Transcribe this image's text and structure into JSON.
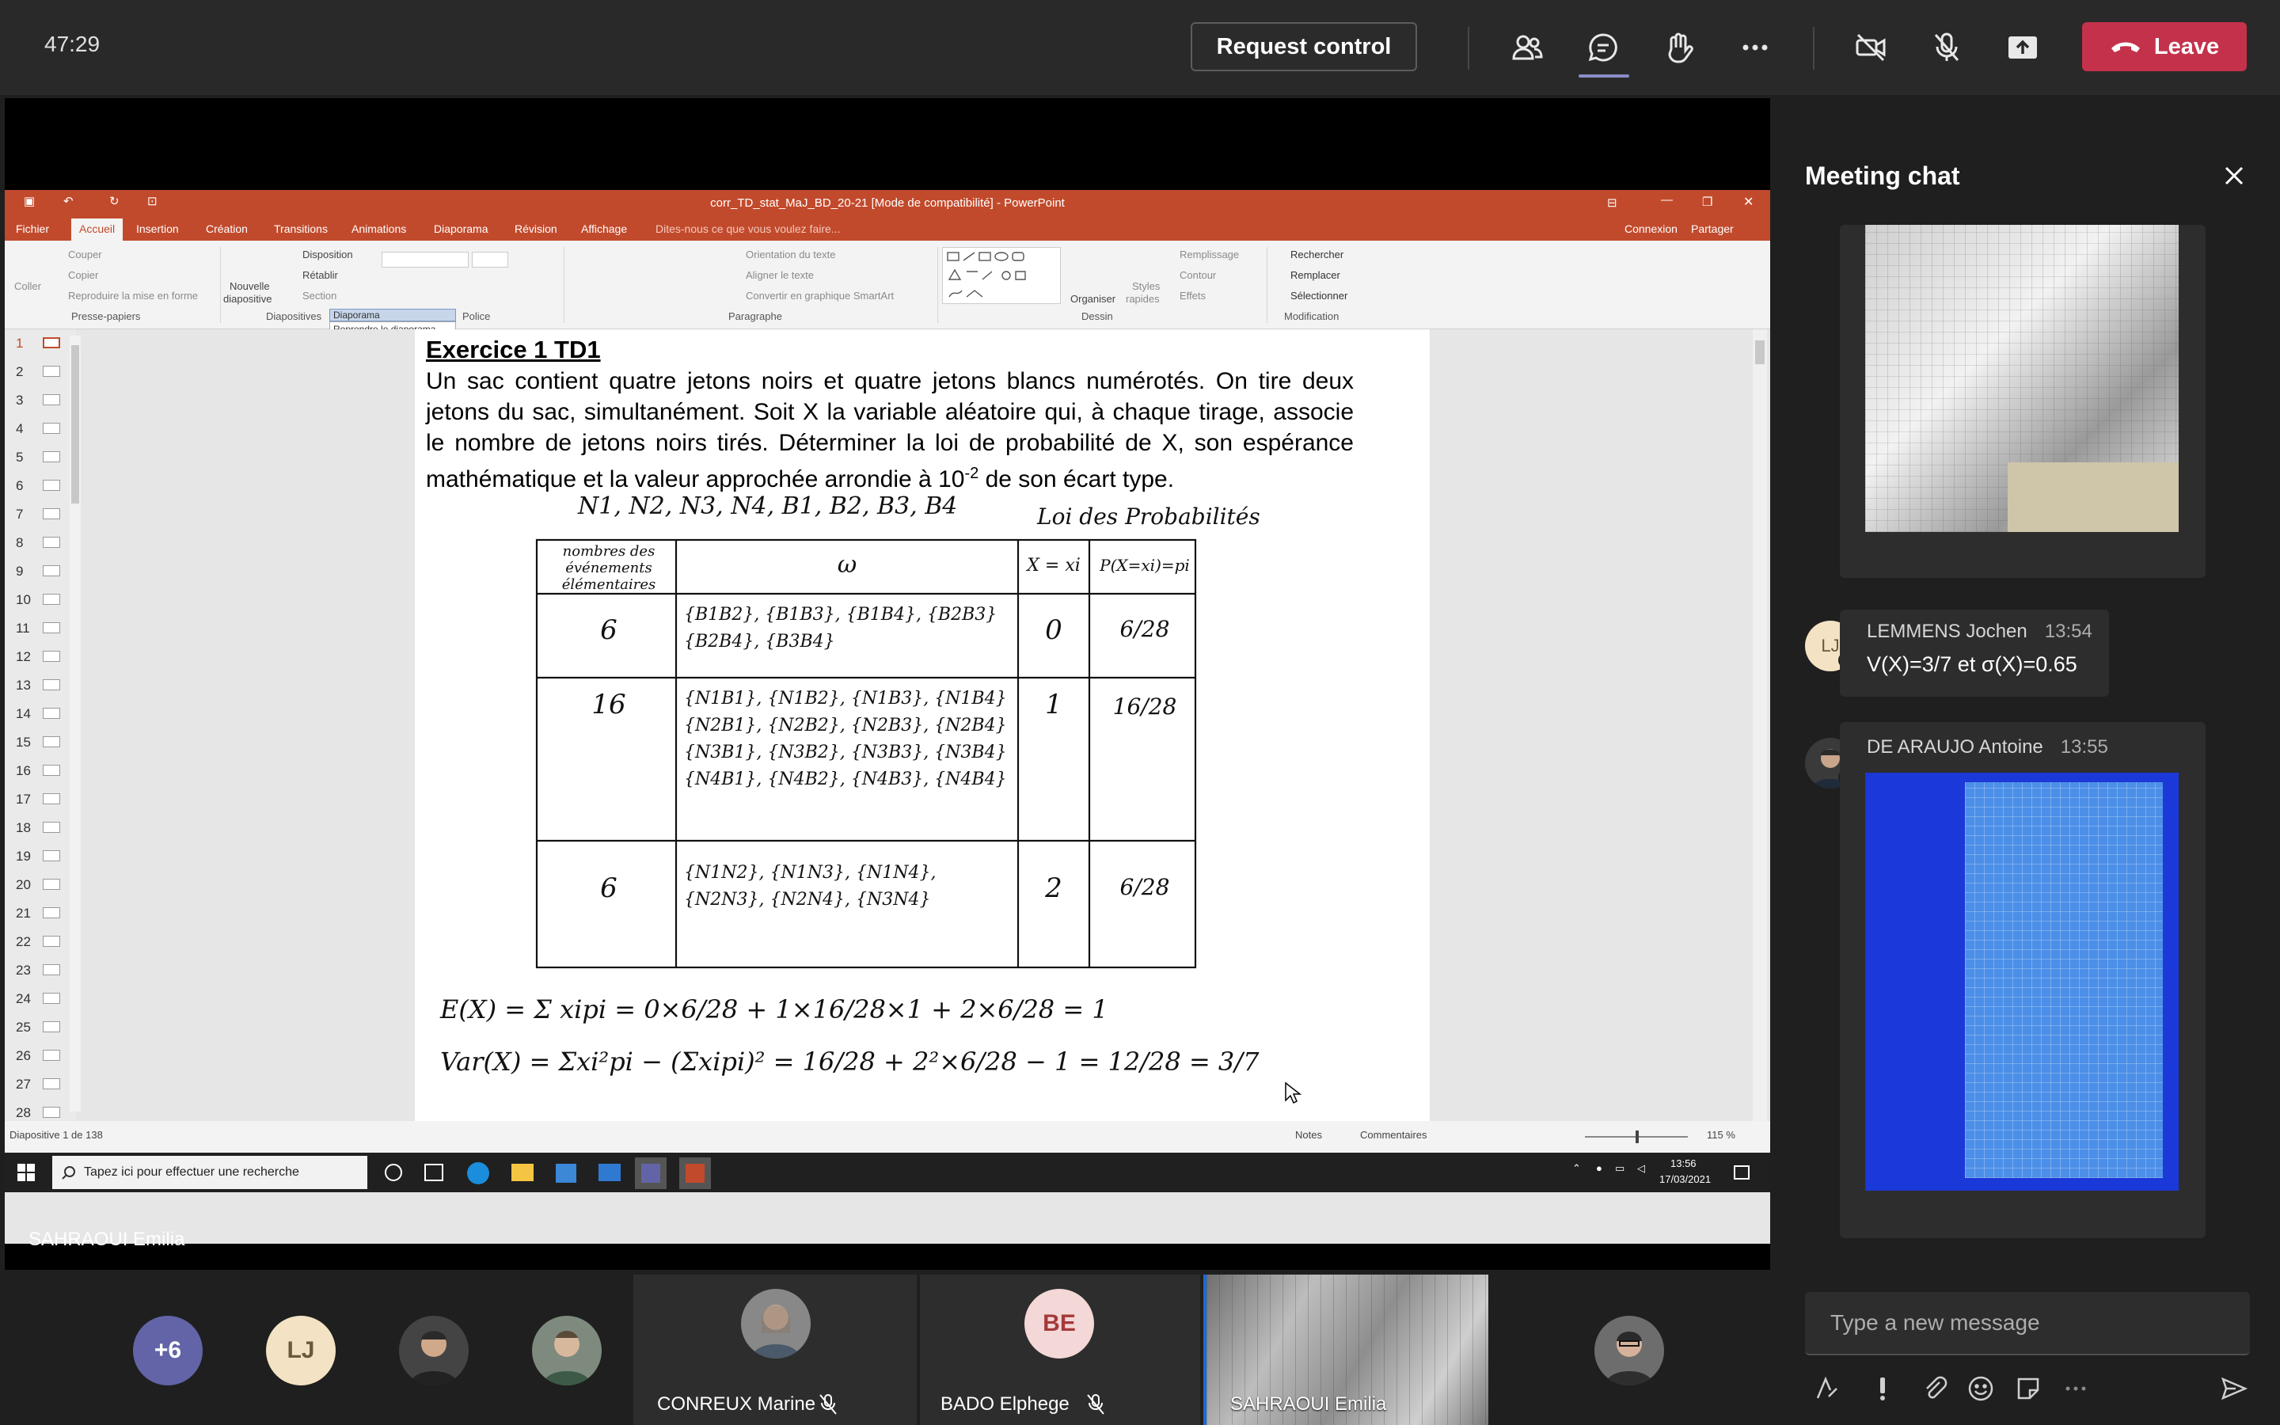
{
  "topbar": {
    "timer": "47:29",
    "request_control": "Request control",
    "leave": "Leave"
  },
  "icons": [
    "people-icon",
    "chat-icon",
    "raise-hand-icon",
    "more-icon",
    "camera-off-icon",
    "mic-off-icon",
    "share-icon",
    "phone-icon"
  ],
  "ppt": {
    "title": "corr_TD_stat_MaJ_BD_20-21 [Mode de compatibilité] - PowerPoint",
    "tabs": [
      "Fichier",
      "Accueil",
      "Insertion",
      "Création",
      "Transitions",
      "Animations",
      "Diaporama",
      "Révision",
      "Affichage"
    ],
    "tell_me": "Dites-nous ce que vous voulez faire...",
    "connexion": "Connexion",
    "partager": "Partager",
    "ribbon": {
      "coller": "Coller",
      "couper": "Couper",
      "copier": "Copier",
      "reproduire": "Reproduire la mise en forme",
      "presse_papiers": "Presse-papiers",
      "nouvelle": "Nouvelle",
      "diapositive": "diapositive",
      "disposition": "Disposition",
      "retablir": "Rétablir",
      "section": "Section",
      "diapositives": "Diapositives",
      "diaporama_popup": "Diaporama",
      "reprendre": "Reprendre le diaporama",
      "police": "Police",
      "orientation": "Orientation du texte",
      "aligner": "Aligner le texte",
      "smartart": "Convertir en graphique SmartArt",
      "paragraphe": "Paragraphe",
      "organiser": "Organiser",
      "styles": "Styles",
      "rapides": "rapides",
      "remplissage": "Remplissage",
      "contour": "Contour",
      "effets": "Effets",
      "dessin": "Dessin",
      "rechercher": "Rechercher",
      "remplacer": "Remplacer",
      "selectionner": "Sélectionner",
      "modification": "Modification"
    },
    "thumb_numbers": [
      "1",
      "2",
      "3",
      "4",
      "5",
      "6",
      "7",
      "8",
      "9",
      "10",
      "11",
      "12",
      "13",
      "14",
      "15",
      "16",
      "17",
      "18",
      "19",
      "20",
      "21",
      "22",
      "23",
      "24",
      "25",
      "26",
      "27",
      "28"
    ],
    "slide": {
      "title": "Exercice 1 TD1",
      "paragraph": "Un sac contient quatre jetons noirs et quatre jetons blancs numérotés. On tire deux jetons du sac, simultanément. Soit X la variable aléatoire qui, à chaque tirage, associe le nombre de jetons noirs tirés. Déterminer la loi de probabilité de X, son espérance mathématique et la valeur approchée arrondie à 10",
      "exp": "-2",
      "paragraph_end": " de son écart type.",
      "hw_header": "N1, N2, N3, N4, B1, B2, B3, B4",
      "hw_loi": "Loi des Probabilités",
      "hw_col1": "nombres des événements élémentaires",
      "hw_col2": "ω",
      "hw_col3": "X = xi",
      "hw_col4": "P(X=xi)=pi",
      "rows": [
        {
          "count": "6",
          "events": "{B1B2}, {B1B3}, {B1B4}, {B2B3} {B2B4}, {B3B4}",
          "x": "0",
          "p": "6/28"
        },
        {
          "count": "16",
          "events": "{N1B1}, {N1B2}, {N1B3}, {N1B4} {N2B1}, {N2B2}, {N2B3}, {N2B4} {N3B1}, {N3B2}, {N3B3}, {N3B4} {N4B1}, {N4B2}, {N4B3}, {N4B4}",
          "x": "1",
          "p": "16/28"
        },
        {
          "count": "6",
          "events": "{N1N2}, {N1N3}, {N1N4}, {N2N3}, {N2N4}, {N3N4}",
          "x": "2",
          "p": "6/28"
        }
      ],
      "formula_e": "E(X) = Σ xipi = 0×6/28 + 1×16/28×1 + 2×6/28 = 1",
      "formula_v": "Var(X) = Σxi²pi − (Σxipi)² = 16/28 + 2²×6/28 − 1 = 12/28 = 3/7"
    },
    "status_left": "Diapositive 1 de 138",
    "notes": "Notes",
    "commentaires": "Commentaires",
    "zoom": "115 %"
  },
  "taskbar": {
    "search": "Tapez ici pour effectuer une recherche",
    "time": "13:56",
    "date": "17/03/2021"
  },
  "presenter": "SAHRAOUI Emilia",
  "chat": {
    "title": "Meeting chat",
    "messages": [
      {
        "initials": "LJ",
        "sender": "LEMMENS Jochen",
        "time": "13:54",
        "text": "V(X)=3/7 et σ(X)=0.65"
      },
      {
        "initials": "",
        "sender": "DE ARAUJO Antoine",
        "time": "13:55",
        "text": ""
      }
    ],
    "compose_placeholder": "Type a new message"
  },
  "participants": [
    {
      "label": "+6"
    },
    {
      "label": "LJ"
    },
    {
      "label": "CONREUX Marine"
    },
    {
      "label": "BE",
      "name": "BADO Elphege"
    },
    {
      "label": "SAHRAOUI Emilia"
    }
  ],
  "colors": {
    "leave": "#c4314b",
    "ppt_brand": "#c24a2c",
    "avatar_purple": "#6264a7",
    "avatar_lj": "#f3e2c4",
    "avatar_be": "#f4d7d7"
  }
}
